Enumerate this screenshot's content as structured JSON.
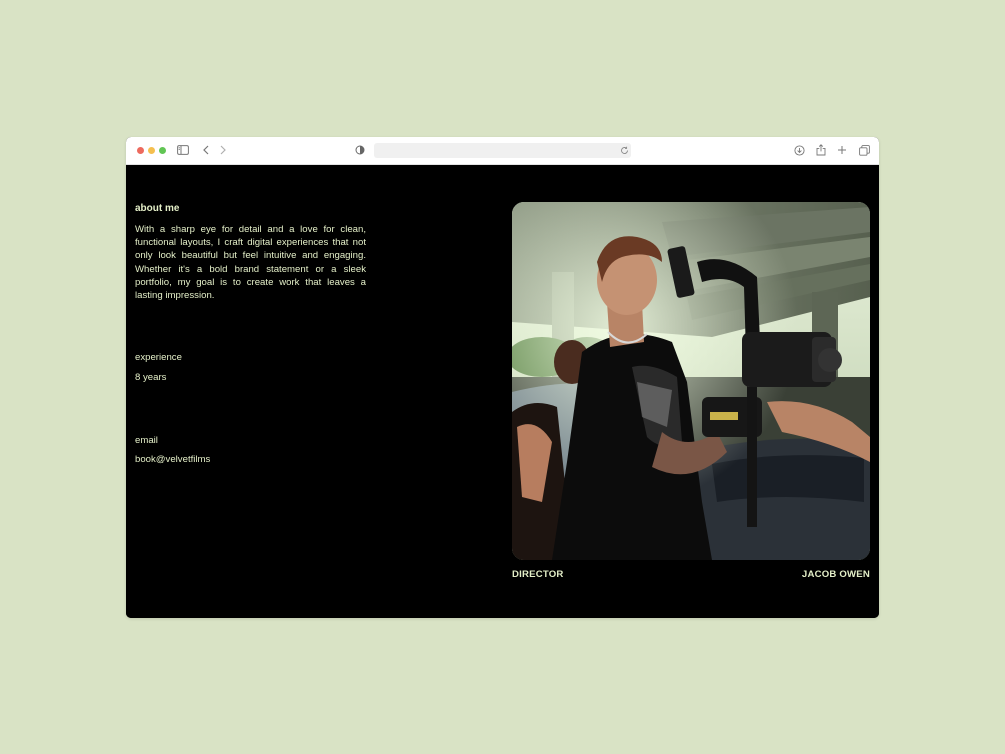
{
  "browser": {
    "traffic_colors": [
      "#ed6a5e",
      "#f5bf4f",
      "#61c554"
    ],
    "address_value": "",
    "icons": [
      "sidebar-icon",
      "back-chevron-icon",
      "forward-chevron-icon",
      "privacy-shield-icon",
      "reload-icon",
      "download-icon",
      "share-icon",
      "new-tab-plus-icon",
      "tabs-overview-icon"
    ]
  },
  "about": {
    "title": "about me",
    "body": "With a sharp eye for detail and a love for clean, functional layouts, I craft digital experiences that not only look beautiful but feel intuitive and engaging. Whether it's a bold brand statement or a sleek portfolio, my goal is to create work that leaves a lasting impression."
  },
  "experience": {
    "label": "experience",
    "value": "8 years"
  },
  "email": {
    "label": "email",
    "value": "book@velvetfilms"
  },
  "photo": {
    "subject": "director-with-cinema-camera-photo"
  },
  "captions": {
    "role": "DIRECTOR",
    "name": "JACOB OWEN"
  },
  "colors": {
    "page_background": "#d9e3c5",
    "content_background": "#000000",
    "text": "#e4efc8"
  }
}
